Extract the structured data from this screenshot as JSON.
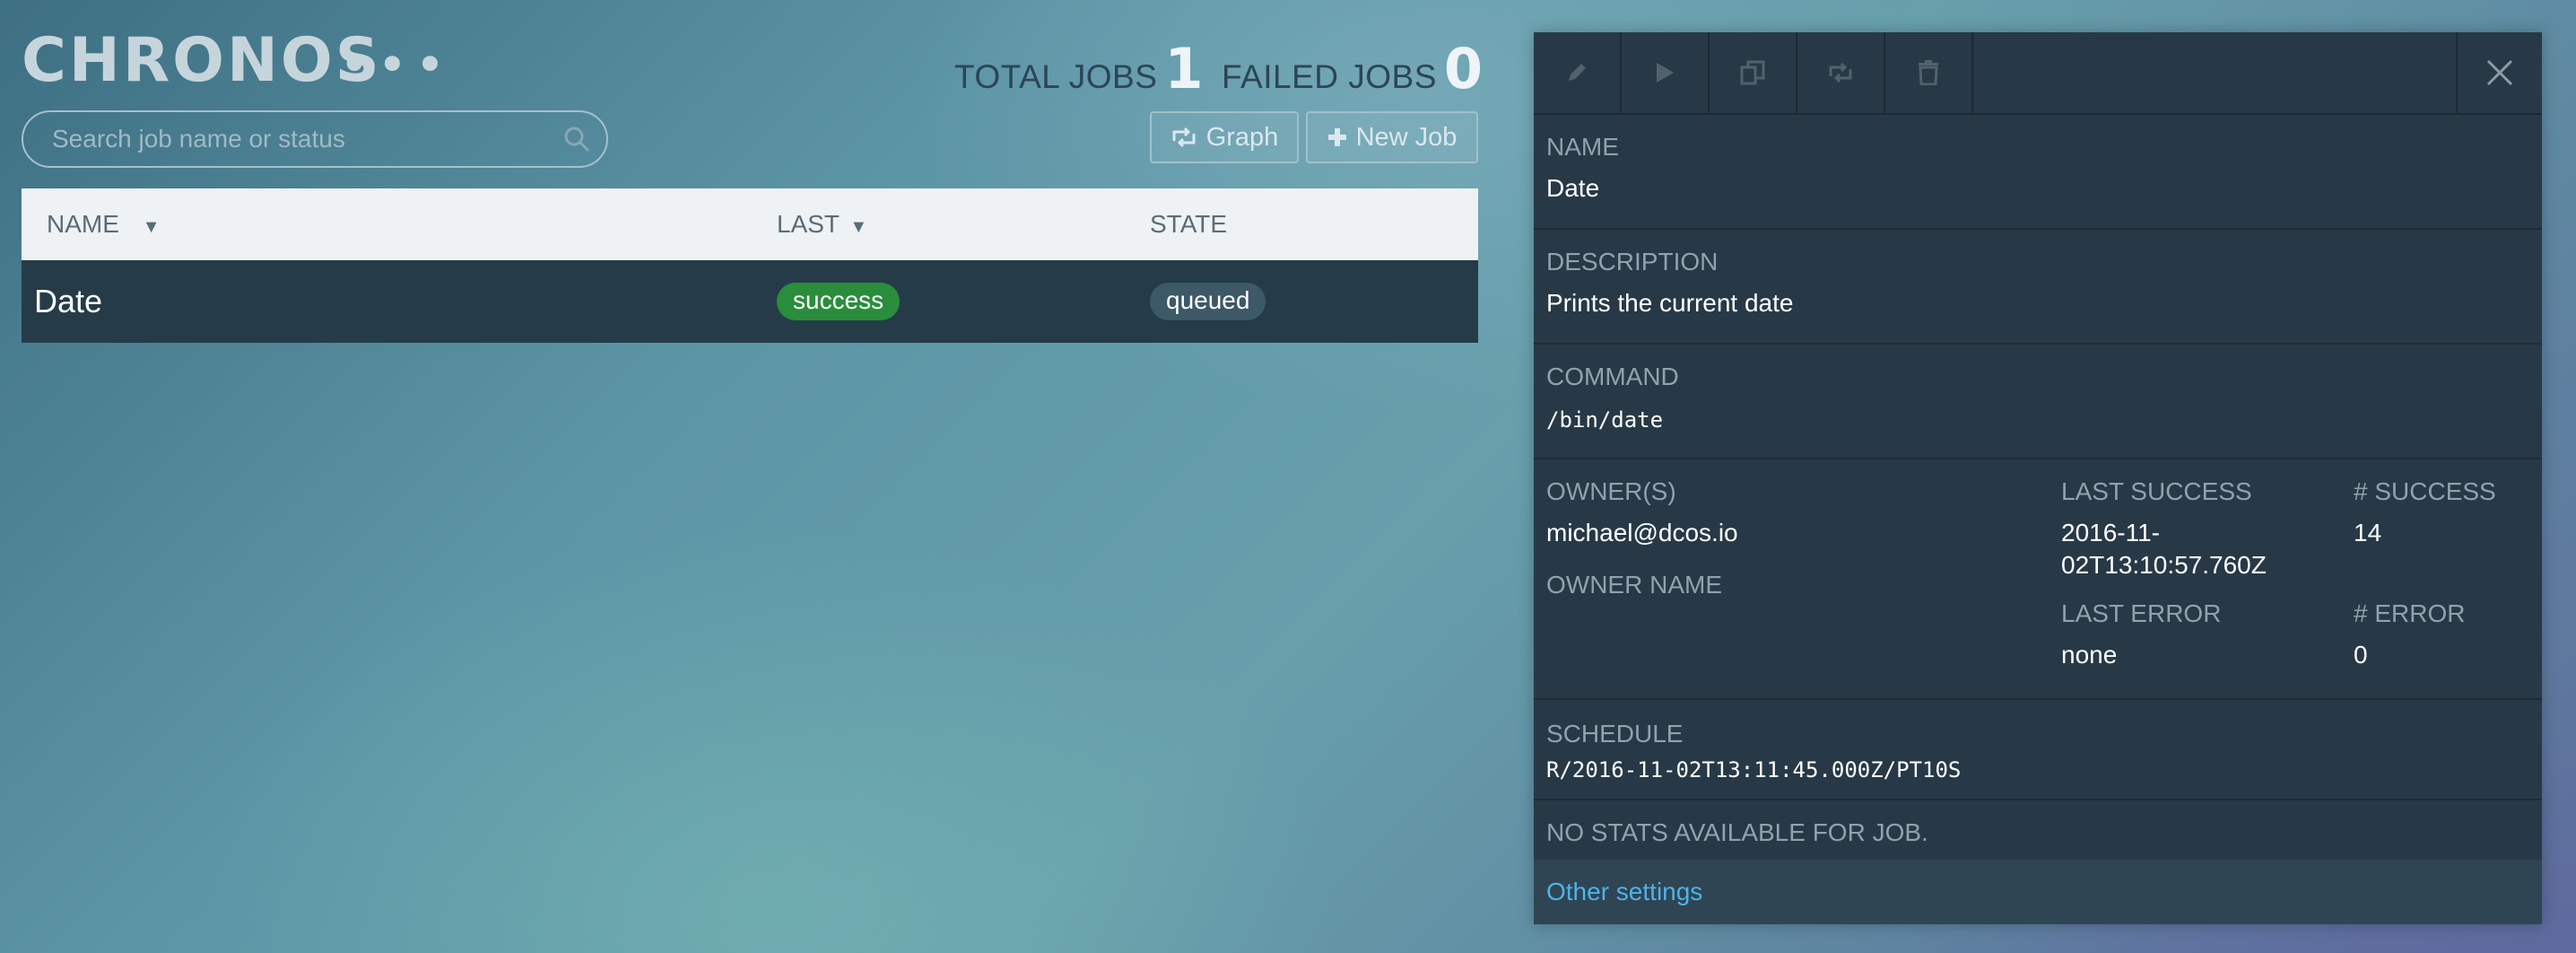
{
  "app": {
    "logo": "CHRONOS",
    "dots": "•••"
  },
  "stats": {
    "total_label": "TOTAL JOBS",
    "total_value": "1",
    "failed_label": "FAILED JOBS",
    "failed_value": "0"
  },
  "search": {
    "placeholder": "Search job name or status",
    "value": ""
  },
  "toolbar": {
    "graph_label": "Graph",
    "new_job_label": "New Job"
  },
  "table": {
    "headers": {
      "name": "NAME",
      "last": "LAST",
      "state": "STATE"
    },
    "rows": [
      {
        "name": "Date",
        "last": "success",
        "state": "queued"
      }
    ]
  },
  "detail": {
    "name_label": "NAME",
    "name_value": "Date",
    "description_label": "DESCRIPTION",
    "description_value": "Prints the current date",
    "command_label": "COMMAND",
    "command_value": "/bin/date",
    "owners_label": "OWNER(S)",
    "owners_value": "michael@dcos.io",
    "owner_name_label": "OWNER NAME",
    "last_success_label": "LAST SUCCESS",
    "last_success_line1": "2016-11-",
    "last_success_line2": "02T13:10:57.760Z",
    "success_count_label": "# SUCCESS",
    "success_count_value": "14",
    "last_error_label": "LAST ERROR",
    "last_error_value": "none",
    "error_count_label": "# ERROR",
    "error_count_value": "0",
    "schedule_label": "SCHEDULE",
    "schedule_value": "R/2016-11-02T13:11:45.000Z/PT10S",
    "no_stats": "NO STATS AVAILABLE FOR JOB.",
    "other_settings": "Other settings"
  },
  "icons": {
    "toolbar": [
      "pencil-icon",
      "play-icon",
      "copy-icon",
      "retweet-icon",
      "trash-icon",
      "close-icon"
    ],
    "search": "magnifier-icon"
  },
  "colors": {
    "success": "#2a8d3c",
    "link": "#4fb2e8",
    "panel": "#273946"
  }
}
